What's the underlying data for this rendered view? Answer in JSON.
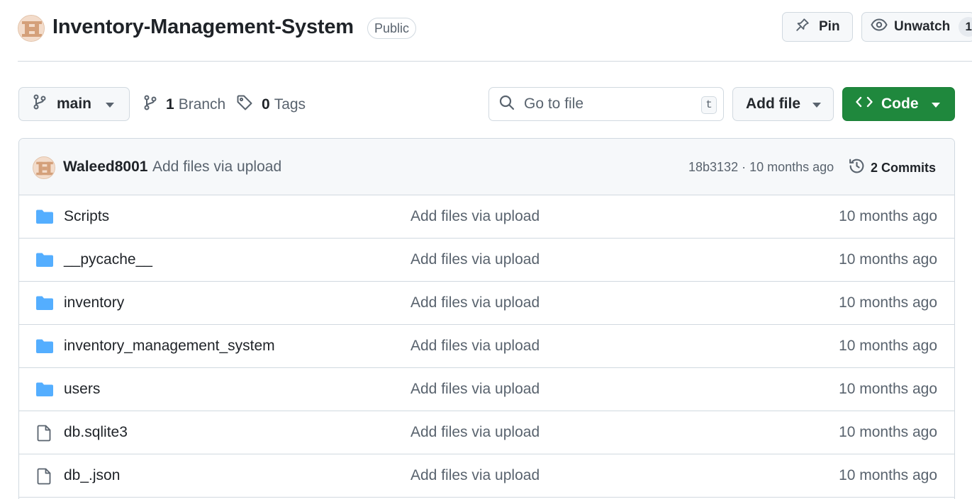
{
  "repo": {
    "name": "Inventory-Management-System",
    "visibility": "Public",
    "pin_label": "Pin",
    "watch_label": "Unwatch",
    "watch_count": "1"
  },
  "toolbar": {
    "branch": "main",
    "branches_count": "1",
    "branches_label": "Branch",
    "tags_count": "0",
    "tags_label": "Tags",
    "search_placeholder": "Go to file",
    "search_shortcut": "t",
    "add_file_label": "Add file",
    "code_label": "Code"
  },
  "latest_commit": {
    "author": "Waleed8001",
    "message": "Add files via upload",
    "meta": "18b3132 · 10 months ago",
    "commits_label": "2 Commits"
  },
  "files": [
    {
      "name": "Scripts",
      "type": "folder",
      "message": "Add files via upload",
      "age": "10 months ago"
    },
    {
      "name": "__pycache__",
      "type": "folder",
      "message": "Add files via upload",
      "age": "10 months ago"
    },
    {
      "name": "inventory",
      "type": "folder",
      "message": "Add files via upload",
      "age": "10 months ago"
    },
    {
      "name": "inventory_management_system",
      "type": "folder",
      "message": "Add files via upload",
      "age": "10 months ago"
    },
    {
      "name": "users",
      "type": "folder",
      "message": "Add files via upload",
      "age": "10 months ago"
    },
    {
      "name": "db.sqlite3",
      "type": "file",
      "message": "Add files via upload",
      "age": "10 months ago"
    },
    {
      "name": "db_.json",
      "type": "file",
      "message": "Add files via upload",
      "age": "10 months ago"
    }
  ],
  "colors": {
    "primary_button": "#1f883d",
    "folder_icon": "#54aeff",
    "muted_text": "#59636e",
    "border": "#d1d9e0"
  }
}
